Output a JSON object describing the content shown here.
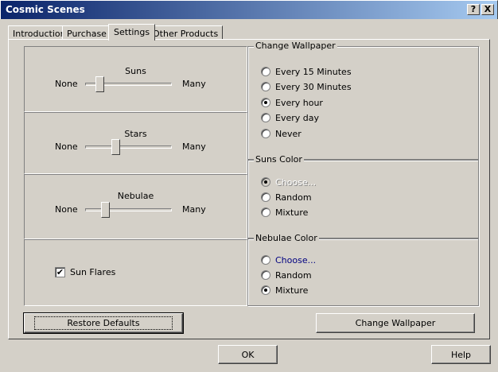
{
  "window": {
    "title": "Cosmic Scenes",
    "help_glyph": "?",
    "close_glyph": "X"
  },
  "tabs": [
    {
      "label": "Introduction",
      "active": false
    },
    {
      "label": "Purchase",
      "active": false
    },
    {
      "label": "Settings",
      "active": true
    },
    {
      "label": "Other Products",
      "active": false
    }
  ],
  "sliders": [
    {
      "title": "Suns",
      "min_label": "None",
      "max_label": "Many",
      "value": 0.15
    },
    {
      "title": "Stars",
      "min_label": "None",
      "max_label": "Many",
      "value": 0.35
    },
    {
      "title": "Nebulae",
      "min_label": "None",
      "max_label": "Many",
      "value": 0.2
    }
  ],
  "sun_flares": {
    "label": "Sun Flares",
    "checked": true,
    "check_glyph": "✔"
  },
  "change_wallpaper": {
    "label": "Change Wallpaper",
    "options": [
      {
        "label": "Every 15 Minutes",
        "checked": false
      },
      {
        "label": "Every 30 Minutes",
        "checked": false
      },
      {
        "label": "Every hour",
        "checked": true
      },
      {
        "label": "Every day",
        "checked": false
      },
      {
        "label": "Never",
        "checked": false
      }
    ]
  },
  "suns_color": {
    "label": "Suns Color",
    "options": [
      {
        "label": "Choose...",
        "checked": true,
        "disabled": true
      },
      {
        "label": "Random",
        "checked": false
      },
      {
        "label": "Mixture",
        "checked": false
      }
    ]
  },
  "nebulae_color": {
    "label": "Nebulae Color",
    "options": [
      {
        "label": "Choose...",
        "checked": false,
        "link": true
      },
      {
        "label": "Random",
        "checked": false
      },
      {
        "label": "Mixture",
        "checked": true
      }
    ]
  },
  "buttons": {
    "restore_defaults": "Restore Defaults",
    "change_wallpaper": "Change Wallpaper",
    "ok": "OK",
    "help": "Help"
  },
  "colors": {
    "titlebar_start": "#0a246a",
    "titlebar_end": "#a6caf0",
    "face": "#d4d0c8",
    "link": "#000080"
  }
}
